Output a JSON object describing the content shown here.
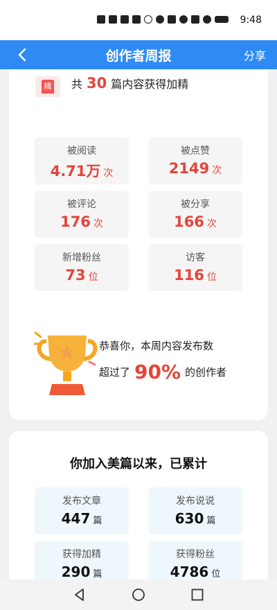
{
  "status_bar": {
    "time": "9:48"
  },
  "header": {
    "title": "创作者周报",
    "share_label": "分享"
  },
  "featured": {
    "badge": "精",
    "prefix": "共",
    "count": "30",
    "suffix": "篇内容获得加精"
  },
  "weekly_stats": [
    {
      "label": "被阅读",
      "value": "4.71万",
      "unit": "次"
    },
    {
      "label": "被点赞",
      "value": "2149",
      "unit": "次"
    },
    {
      "label": "被评论",
      "value": "176",
      "unit": "次"
    },
    {
      "label": "被分享",
      "value": "166",
      "unit": "次"
    },
    {
      "label": "新增粉丝",
      "value": "73",
      "unit": "位"
    },
    {
      "label": "访客",
      "value": "116",
      "unit": "位"
    }
  ],
  "congrats": {
    "line1": "恭喜你，本周内容发布数",
    "prefix": "超过了",
    "percent": "90%",
    "suffix": "的创作者"
  },
  "totals": {
    "title": "你加入美篇以来，已累计",
    "items": [
      {
        "label": "发布文章",
        "value": "447",
        "unit": "篇"
      },
      {
        "label": "发布说说",
        "value": "630",
        "unit": "篇"
      },
      {
        "label": "获得加精",
        "value": "290",
        "unit": "篇"
      },
      {
        "label": "获得粉丝",
        "value": "4786",
        "unit": "位"
      }
    ]
  },
  "colors": {
    "header": "#2f8bf3",
    "accent": "#e5443a",
    "card_bg": "#ffffff",
    "page_bg": "#f0f1f3"
  }
}
